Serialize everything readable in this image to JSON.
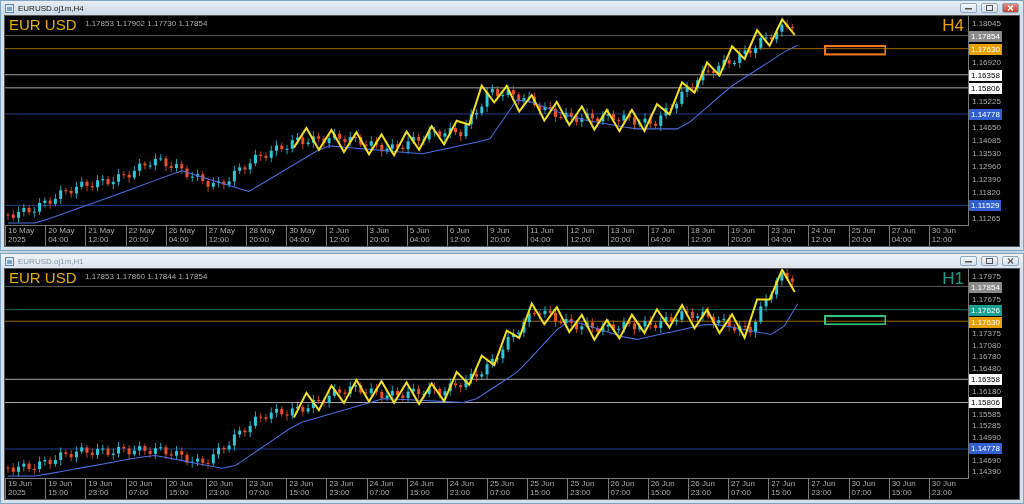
{
  "windows": [
    {
      "title": "EURUSD.oj1m,H4",
      "active": true,
      "symbol_label": "EUR USD",
      "info": "1.17853 1.17902 1.17730 1.17854",
      "timeframe": "H4",
      "price_axis": [
        {
          "kind": "tick",
          "text": "1.18045"
        },
        {
          "kind": "tag",
          "text": "1.17854",
          "color": "#8a8a8a"
        },
        {
          "kind": "tag",
          "text": "1.17630",
          "color": "#e8a000"
        },
        {
          "kind": "tick",
          "text": "1.16920"
        },
        {
          "kind": "tag",
          "text": "1.16358",
          "color": "#ffffff"
        },
        {
          "kind": "tag",
          "text": "1.15806",
          "color": "#ffffff"
        },
        {
          "kind": "tick",
          "text": "1.15225"
        },
        {
          "kind": "tag",
          "text": "1.14778",
          "color": "#2f5fd0"
        },
        {
          "kind": "tick",
          "text": "1.14650"
        },
        {
          "kind": "tick",
          "text": "1.14085"
        },
        {
          "kind": "tick",
          "text": "1.13530"
        },
        {
          "kind": "tick",
          "text": "1.12960"
        },
        {
          "kind": "tick",
          "text": "1.12390"
        },
        {
          "kind": "tick",
          "text": "1.11820"
        },
        {
          "kind": "tag",
          "text": "1.11529",
          "color": "#2f5fd0"
        },
        {
          "kind": "tick",
          "text": "1.11265"
        }
      ],
      "time_axis": [
        "16 May 2025",
        "20 May 04:00",
        "21 May 12:00",
        "22 May 20:00",
        "26 May 04:00",
        "27 May 12:00",
        "28 May 20:00",
        "30 May 04:00",
        "2 Jun 12:00",
        "3 Jun 20:00",
        "5 Jun 04:00",
        "6 Jun 12:00",
        "9 Jun 20:00",
        "11 Jun 04:00",
        "12 Jun 12:00",
        "13 Jun 20:00",
        "17 Jun 04:00",
        "18 Jun 12:00",
        "19 Jun 20:00",
        "23 Jun 04:00",
        "24 Jun 12:00",
        "25 Jun 20:00",
        "27 Jun 04:00",
        "30 Jun 12:00"
      ]
    },
    {
      "title": "EURUSD.oj1m,H1",
      "active": false,
      "symbol_label": "EUR USD",
      "info": "1.17853 1.17860 1.17844 1.17854",
      "timeframe": "H1",
      "price_axis": [
        {
          "kind": "tick",
          "text": "1.17975"
        },
        {
          "kind": "tag",
          "text": "1.17854",
          "color": "#8a8a8a"
        },
        {
          "kind": "tick",
          "text": "1.17675"
        },
        {
          "kind": "tag",
          "text": "1.17626",
          "color": "#16a090"
        },
        {
          "kind": "tag",
          "text": "1.17630",
          "color": "#e8a000"
        },
        {
          "kind": "tick",
          "text": "1.17375"
        },
        {
          "kind": "tick",
          "text": "1.17080"
        },
        {
          "kind": "tick",
          "text": "1.16780"
        },
        {
          "kind": "tick",
          "text": "1.16480"
        },
        {
          "kind": "tag",
          "text": "1.16358",
          "color": "#ffffff"
        },
        {
          "kind": "tick",
          "text": "1.16180"
        },
        {
          "kind": "tag",
          "text": "1.15806",
          "color": "#ffffff"
        },
        {
          "kind": "tick",
          "text": "1.15585"
        },
        {
          "kind": "tick",
          "text": "1.15285"
        },
        {
          "kind": "tick",
          "text": "1.14990"
        },
        {
          "kind": "tag",
          "text": "1.14778",
          "color": "#2f5fd0"
        },
        {
          "kind": "tick",
          "text": "1.14690"
        },
        {
          "kind": "tick",
          "text": "1.14390"
        }
      ],
      "time_axis": [
        "19 Jun 2025",
        "19 Jun 15:00",
        "19 Jun 23:00",
        "20 Jun 07:00",
        "20 Jun 15:00",
        "20 Jun 23:00",
        "23 Jun 07:00",
        "23 Jun 15:00",
        "23 Jun 23:00",
        "24 Jun 07:00",
        "24 Jun 15:00",
        "24 Jun 23:00",
        "25 Jun 07:00",
        "25 Jun 15:00",
        "25 Jun 23:00",
        "26 Jun 07:00",
        "26 Jun 15:00",
        "26 Jun 23:00",
        "27 Jun 07:00",
        "27 Jun 15:00",
        "27 Jun 23:00",
        "30 Jun 07:00",
        "30 Jun 15:00",
        "30 Jun 23:00"
      ]
    }
  ]
}
